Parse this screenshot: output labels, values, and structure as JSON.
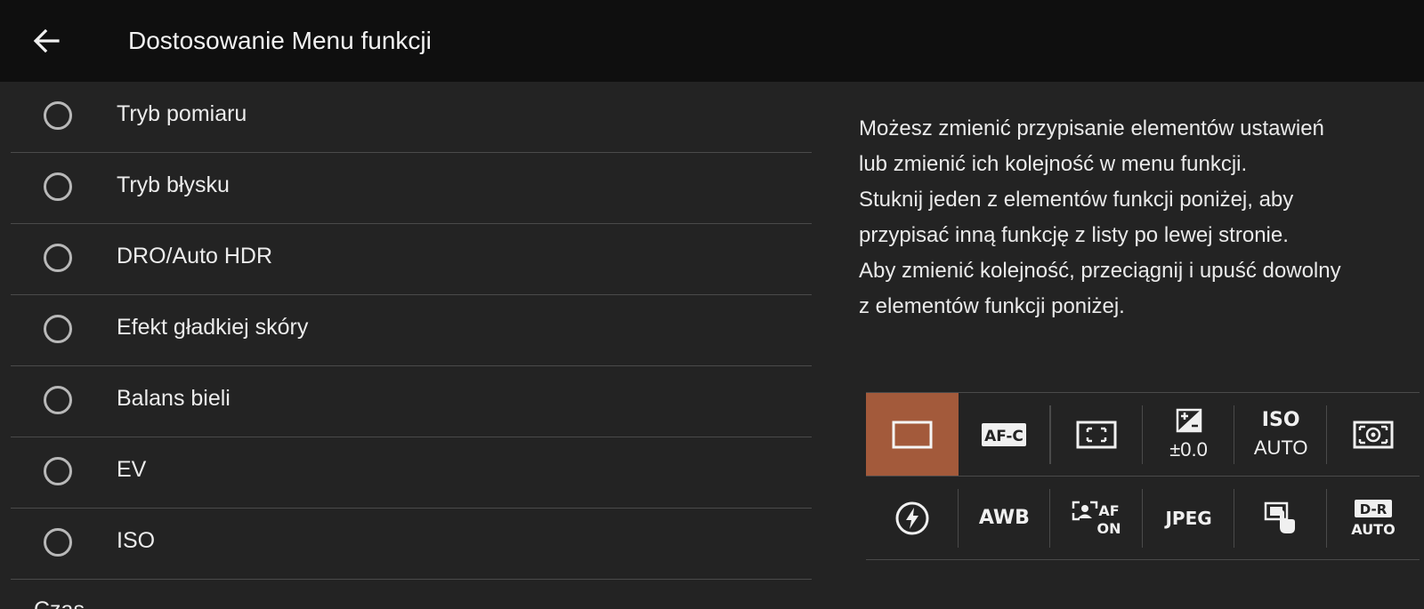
{
  "header": {
    "title": "Dostosowanie Menu funkcji"
  },
  "list": {
    "items": [
      {
        "label": "Tryb pomiaru"
      },
      {
        "label": "Tryb błysku"
      },
      {
        "label": "DRO/Auto HDR"
      },
      {
        "label": "Efekt gładkiej skóry"
      },
      {
        "label": "Balans bieli"
      },
      {
        "label": "EV"
      },
      {
        "label": "ISO"
      }
    ],
    "partial_item": "Czas..."
  },
  "description": {
    "lines": [
      "Możesz zmienić przypisanie elementów ustawień",
      "lub zmienić ich kolejność w menu funkcji.",
      "Stuknij jeden z elementów funkcji poniżej, aby",
      "przypisać inną funkcję z listy po lewej stronie.",
      "Aby zmienić kolejność, przeciągnij i upuść dowolny",
      "z elementów funkcji poniżej."
    ]
  },
  "function_grid": {
    "accent_color": "#a35a3b",
    "row1": [
      {
        "icon": "drive-mode-single-icon",
        "selected": true
      },
      {
        "icon": "af-c-focus-mode-icon",
        "icon_text": "AF-C"
      },
      {
        "icon": "focus-area-icon"
      },
      {
        "icon": "exposure-comp-icon",
        "value": "±0.0"
      },
      {
        "icon": "iso-icon",
        "icon_text": "ISO",
        "value": "AUTO"
      },
      {
        "icon": "metering-mode-icon"
      }
    ],
    "row2": [
      {
        "icon": "flash-mode-icon"
      },
      {
        "icon": "white-balance-icon",
        "icon_text": "AWB"
      },
      {
        "icon": "face-eye-af-icon",
        "icon_text_1": "AF",
        "icon_text_2": "ON"
      },
      {
        "icon": "file-format-icon",
        "icon_text": "JPEG"
      },
      {
        "icon": "touch-function-icon"
      },
      {
        "icon": "dro-auto-icon",
        "icon_text_1": "D-R",
        "icon_text_2": "AUTO"
      }
    ]
  }
}
